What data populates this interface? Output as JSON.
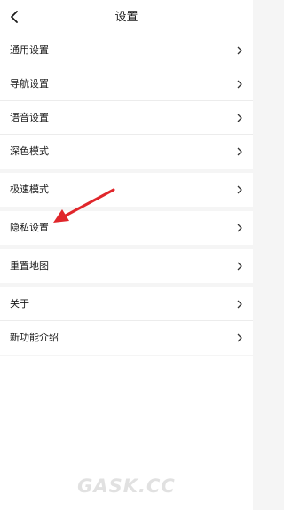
{
  "header": {
    "title": "设置",
    "back_icon": "chevron-left-icon"
  },
  "groups": [
    {
      "items": [
        {
          "label": "通用设置",
          "chevron": "›"
        },
        {
          "label": "导航设置",
          "chevron": "›"
        },
        {
          "label": "语音设置",
          "chevron": "›"
        },
        {
          "label": "深色模式",
          "chevron": "›"
        }
      ]
    },
    {
      "items": [
        {
          "label": "极速模式",
          "chevron": "›"
        }
      ]
    },
    {
      "items": [
        {
          "label": "隐私设置",
          "chevron": "›"
        }
      ]
    },
    {
      "items": [
        {
          "label": "重置地图",
          "chevron": "›"
        }
      ]
    },
    {
      "items": [
        {
          "label": "关于",
          "chevron": "›"
        },
        {
          "label": "新功能介绍",
          "chevron": "›"
        }
      ]
    }
  ],
  "watermark": {
    "text": "GASK.CC"
  },
  "colors": {
    "background": "#f5f5f5",
    "row": "#ffffff",
    "arrow": "#e0262b",
    "divider": "#ececec"
  }
}
